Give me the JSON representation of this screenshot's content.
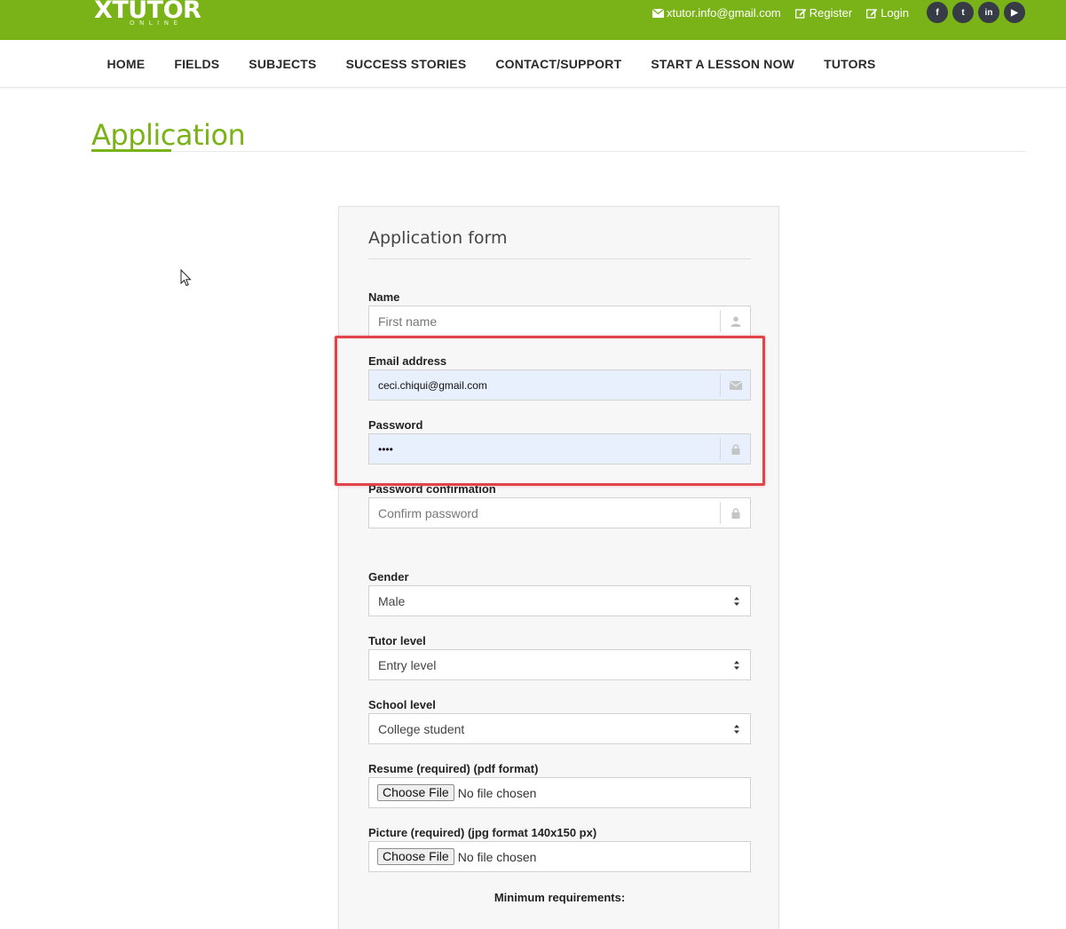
{
  "header": {
    "logo_main": "XTUTOR",
    "logo_sub": "ONLINE",
    "email": "xtutor.info@gmail.com",
    "register": "Register",
    "login": "Login",
    "brand_color": "#7ab317",
    "social": [
      {
        "icon": "facebook-icon",
        "glyph": "f"
      },
      {
        "icon": "twitter-icon",
        "glyph": "t"
      },
      {
        "icon": "linkedin-icon",
        "glyph": "in"
      },
      {
        "icon": "youtube-icon",
        "glyph": "▶"
      }
    ]
  },
  "nav": {
    "items": [
      "HOME",
      "FIELDS",
      "SUBJECTS",
      "SUCCESS STORIES",
      "CONTACT/SUPPORT",
      "START A LESSON NOW",
      "TUTORS"
    ]
  },
  "page": {
    "title": "Application"
  },
  "form": {
    "title": "Application form",
    "name_label": "Name",
    "name_placeholder": "First name",
    "email_label": "Email address",
    "email_value": "ceci.chiqui@gmail.com",
    "password_label": "Password",
    "password_value": "••••",
    "confirm_label": "Password confirmation",
    "confirm_placeholder": "Confirm password",
    "gender_label": "Gender",
    "gender_value": "Male",
    "tutor_level_label": "Tutor level",
    "tutor_level_value": "Entry level",
    "school_level_label": "School level",
    "school_level_value": "College student",
    "resume_label": "Resume (required) (pdf format)",
    "picture_label": "Picture (required) (jpg format 140x150 px)",
    "choose_file": "Choose File",
    "no_file": "No file chosen",
    "min_requirements": "Minimum requirements:",
    "highlight_color": "#e0434a"
  }
}
